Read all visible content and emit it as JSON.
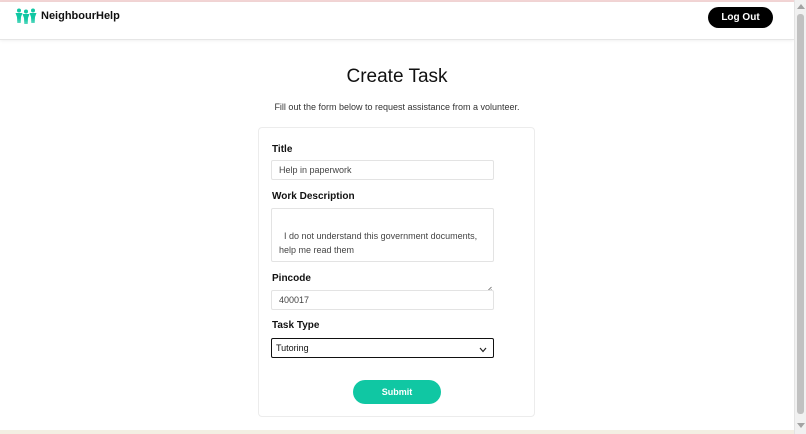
{
  "app": {
    "name": "NeighbourHelp"
  },
  "nav": {
    "logout_label": "Log Out"
  },
  "page": {
    "title": "Create Task",
    "subtitle": "Fill out the form below to request assistance from a volunteer."
  },
  "form": {
    "title": {
      "label": "Title",
      "value": "Help in paperwork"
    },
    "description": {
      "label": "Work Description",
      "value": "I do not understand this government documents,\nhelp me read them"
    },
    "pincode": {
      "label": "Pincode",
      "value": "400017"
    },
    "task_type": {
      "label": "Task Type",
      "selected": "Tutoring"
    },
    "submit_label": "Submit"
  },
  "colors": {
    "accent": "#10c7a3",
    "logout_bg": "#000000"
  },
  "icons": {
    "logo": "people-group-icon",
    "select": "chevron-down-icon",
    "resize": "resize-grip-icon"
  }
}
